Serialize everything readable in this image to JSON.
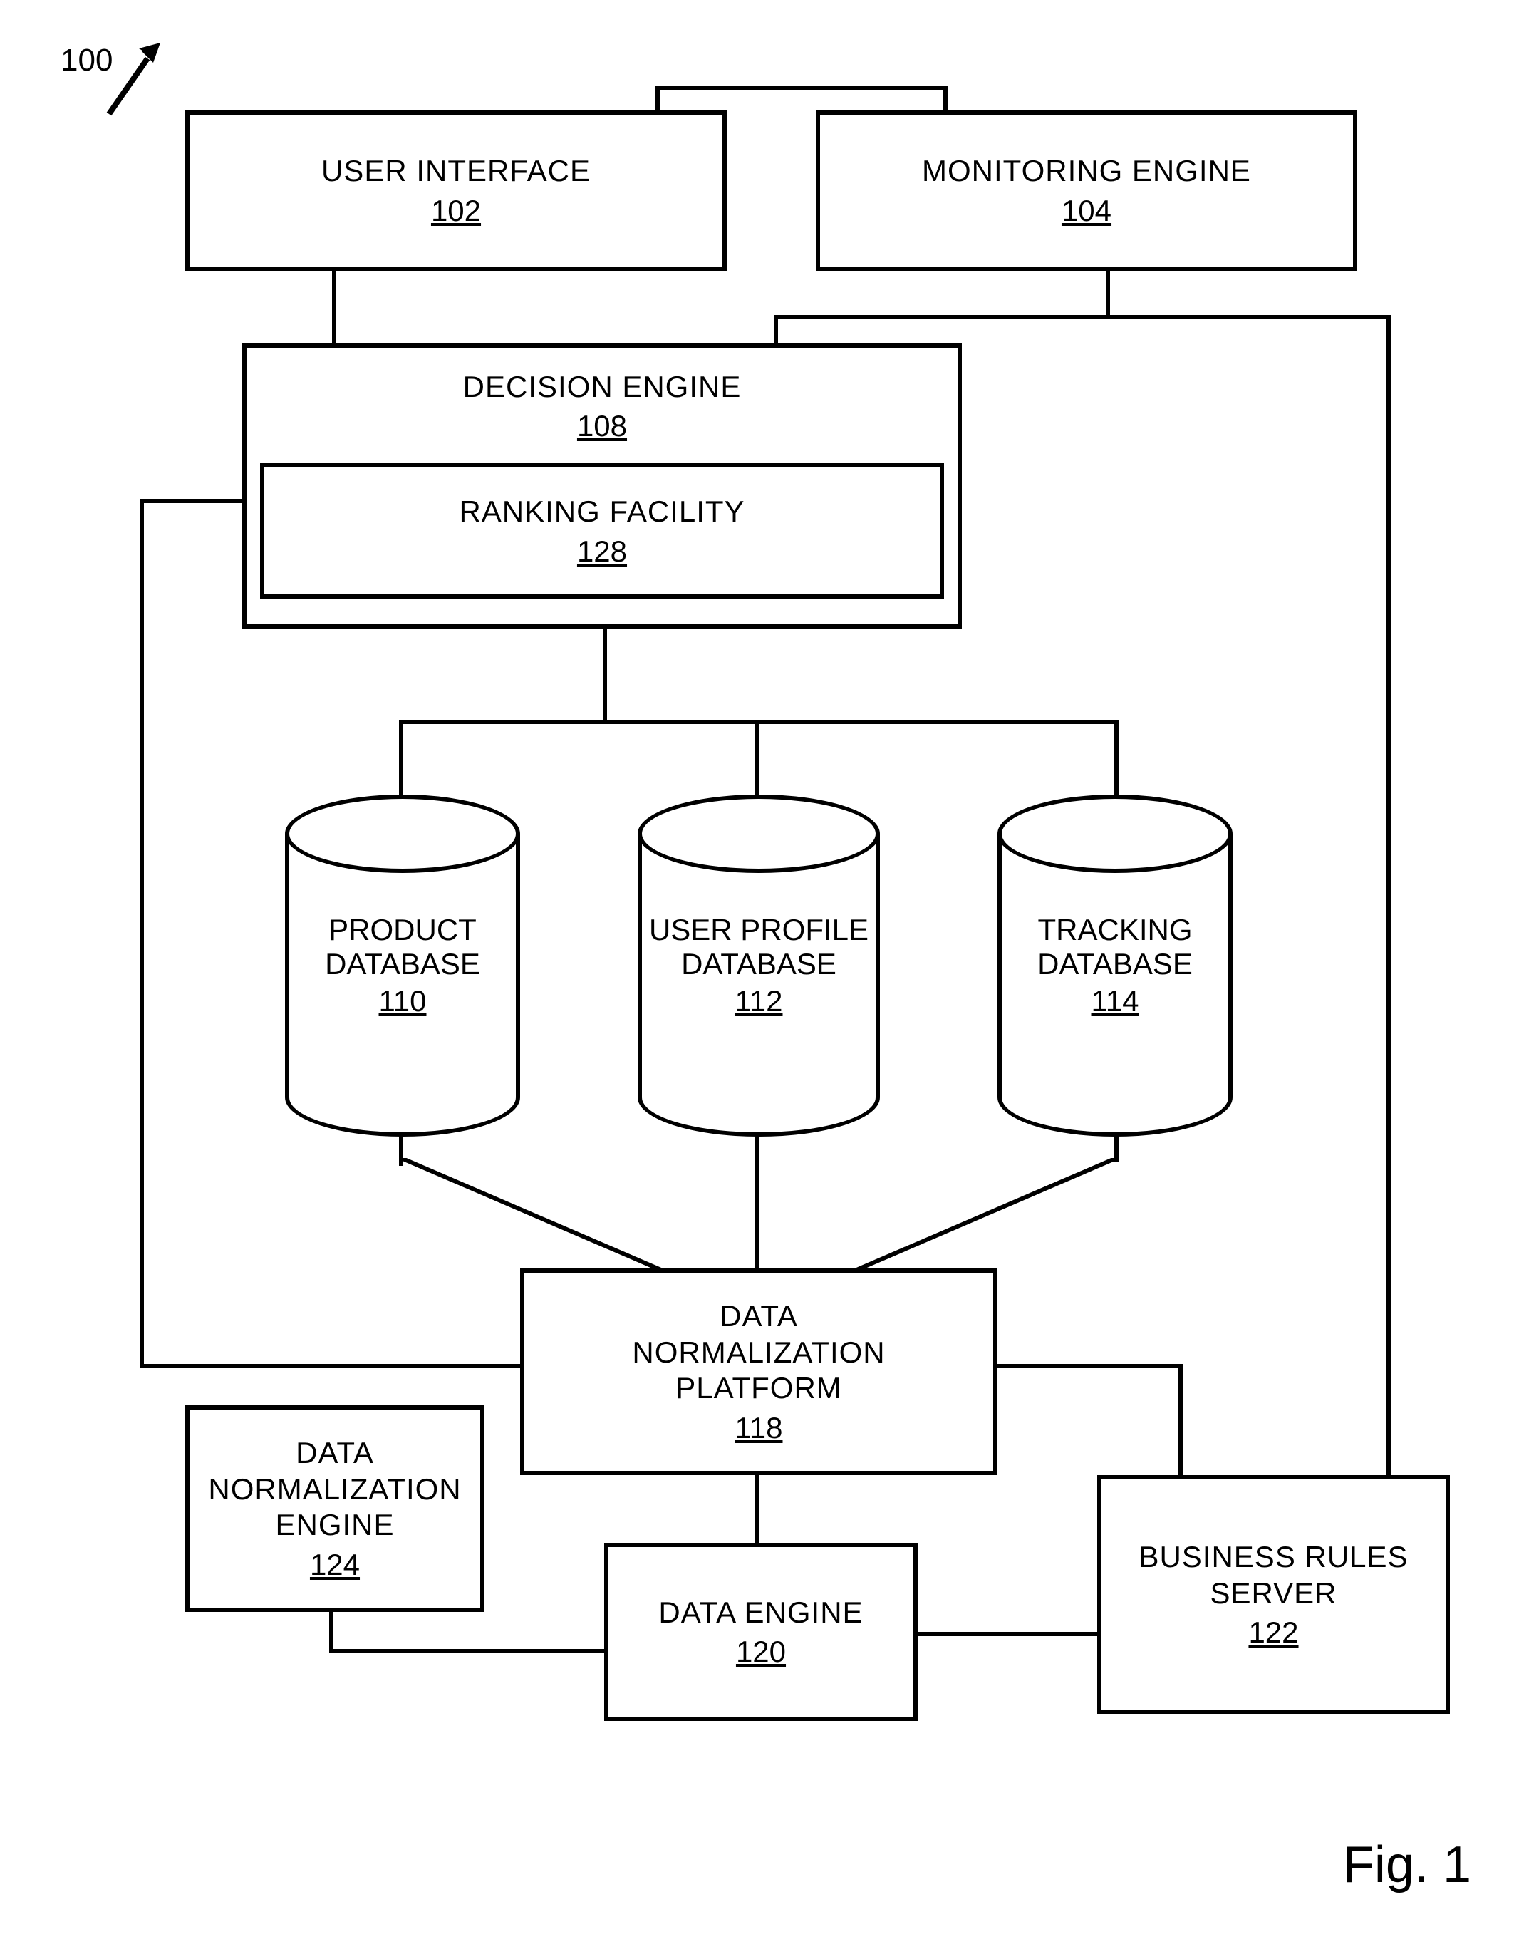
{
  "diagram_ref": "100",
  "figure_label": "Fig. 1",
  "boxes": {
    "user_interface": {
      "label": "USER INTERFACE",
      "num": "102"
    },
    "monitoring_engine": {
      "label": "MONITORING ENGINE",
      "num": "104"
    },
    "decision_engine": {
      "label": "DECISION ENGINE",
      "num": "108"
    },
    "ranking_facility": {
      "label": "RANKING FACILITY",
      "num": "128"
    },
    "data_norm_platform": {
      "label_l1": "DATA",
      "label_l2": "NORMALIZATION",
      "label_l3": "PLATFORM",
      "num": "118"
    },
    "data_norm_engine": {
      "label_l1": "DATA",
      "label_l2": "NORMALIZATION",
      "label_l3": "ENGINE",
      "num": "124"
    },
    "data_engine": {
      "label": "DATA ENGINE",
      "num": "120"
    },
    "business_rules": {
      "label_l1": "BUSINESS RULES",
      "label_l2": "SERVER",
      "num": "122"
    }
  },
  "cylinders": {
    "product_db": {
      "label_l1": "PRODUCT",
      "label_l2": "DATABASE",
      "num": "110"
    },
    "user_profile_db": {
      "label_l1": "USER PROFILE",
      "label_l2": "DATABASE",
      "num": "112"
    },
    "tracking_db": {
      "label_l1": "TRACKING",
      "label_l2": "DATABASE",
      "num": "114"
    }
  }
}
